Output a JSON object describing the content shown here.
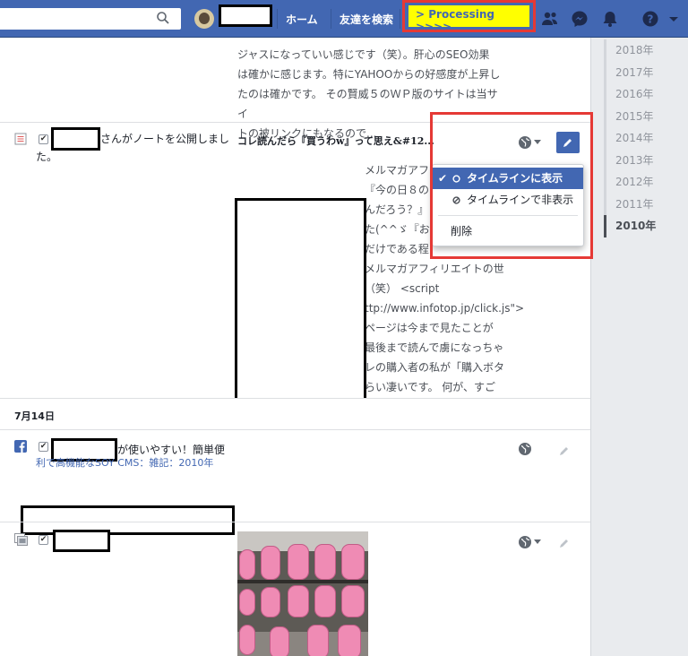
{
  "header": {
    "nav_home": "ホーム",
    "nav_find_friends": "友達を検索",
    "processing_label": "> Processing >>>>"
  },
  "timeline": {
    "top_post_lines": [
      "ジャスになっていい感じです（笑）。肝心のSEO効果",
      "は確かに感じます。特にYAHOOからの好感度が上昇し",
      "たのは確かです。 その賢威５のＷＰ版のサイトは当サイ",
      "トの被リンクにもなるので..."
    ],
    "note_post": {
      "actor_suffix": "さんがノートを公開しまし",
      "actor_suffix2": "た。",
      "title": "コレ読んだら『買うわw』って思え&#12...",
      "body_lines": [
        "メルマガアフ",
        "『今の日８の",
        "んだろう？』",
        "た(^^ゞ『おい",
        "だけである程",
        "メルマガアフィリエイトの世",
        "（笑） <script",
        "ttp://www.infotop.jp/click.js\">",
        "ページは今まで見たことが",
        "最後まで読んで虜になっちゃ",
        "レの購入者の私が「購入ボタ",
        "らい凄いです。 何が、すご"
      ]
    },
    "day_header": "7月14日",
    "link_post": {
      "line1_suffix": "が使いやすい！簡単便",
      "line2": "利で高機能なSOY CMS：雑記：2010年"
    }
  },
  "dropdown": {
    "show_label": "タイムラインに表示",
    "hide_label": "タイムラインで非表示",
    "delete_label": "削除"
  },
  "years": [
    "2018年",
    "2017年",
    "2016年",
    "2015年",
    "2014年",
    "2013年",
    "2012年",
    "2011年",
    "2010年"
  ],
  "colors": {
    "brand_blue": "#4267b2",
    "highlight_yellow": "#ffff00",
    "annotation_red": "#e53935"
  }
}
